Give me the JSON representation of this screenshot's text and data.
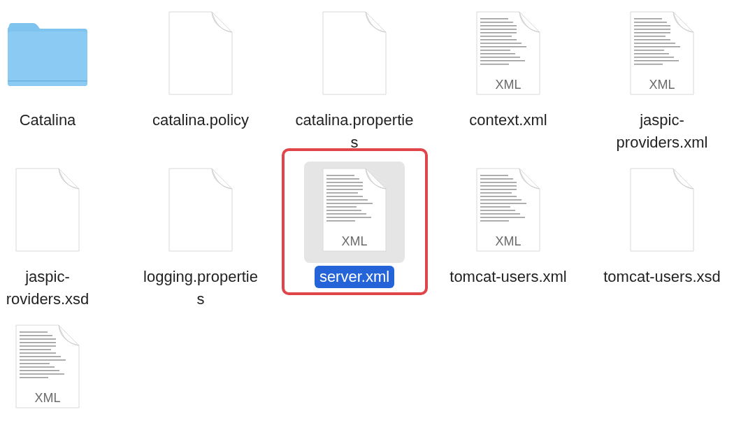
{
  "items": [
    {
      "kind": "folder",
      "label": [
        "Catalina"
      ],
      "selected": false,
      "annotated": false
    },
    {
      "kind": "blank",
      "label": [
        "catalina.policy"
      ],
      "selected": false,
      "annotated": false
    },
    {
      "kind": "blank",
      "label": [
        "catalina.propertie",
        "s"
      ],
      "selected": false,
      "annotated": false
    },
    {
      "kind": "preview",
      "badge": "XML",
      "label": [
        "context.xml"
      ],
      "selected": false,
      "annotated": false
    },
    {
      "kind": "preview",
      "badge": "XML",
      "label": [
        "jaspic-",
        "providers.xml"
      ],
      "selected": false,
      "annotated": false
    },
    {
      "kind": "blank",
      "label": [
        "jaspic-",
        "roviders.xsd"
      ],
      "selected": false,
      "annotated": false
    },
    {
      "kind": "blank",
      "label": [
        "logging.propertie",
        "s"
      ],
      "selected": false,
      "annotated": false
    },
    {
      "kind": "preview",
      "badge": "XML",
      "label": [
        "server.xml"
      ],
      "selected": true,
      "annotated": true
    },
    {
      "kind": "preview",
      "badge": "XML",
      "label": [
        "tomcat-users.xml"
      ],
      "selected": false,
      "annotated": false
    },
    {
      "kind": "blank",
      "label": [
        "tomcat-users.xsd"
      ],
      "selected": false,
      "annotated": false
    },
    {
      "kind": "preview",
      "badge": "XML",
      "selected": false,
      "annotated": false
    }
  ]
}
